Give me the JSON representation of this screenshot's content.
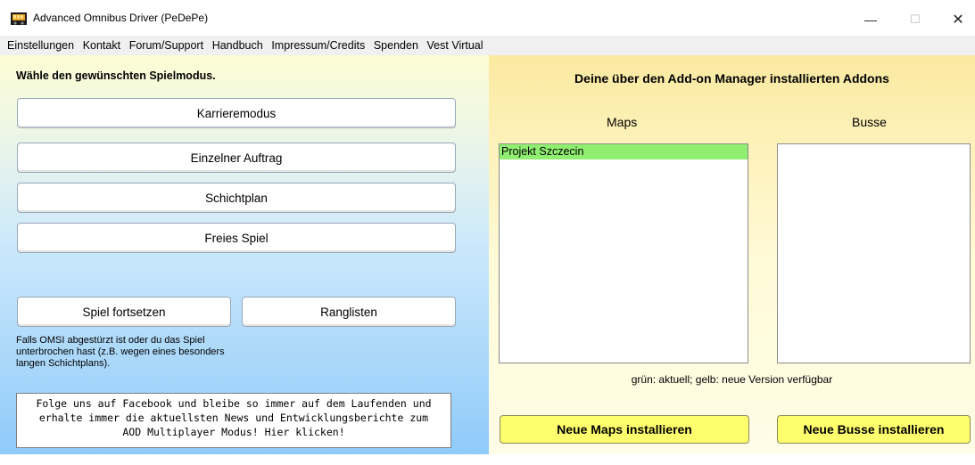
{
  "window": {
    "title": "Advanced Omnibus Driver (PeDePe)",
    "minimize_glyph": "—",
    "maximize_glyph": "☐",
    "close_glyph": "✕"
  },
  "menu": {
    "items": [
      "Einstellungen",
      "Kontakt",
      "Forum/Support",
      "Handbuch",
      "Impressum/Credits",
      "Spenden",
      "Vest Virtual"
    ]
  },
  "left": {
    "prompt": "Wähle den gewünschten Spielmodus.",
    "buttons": {
      "career": "Karrieremodus",
      "single_job": "Einzelner Auftrag",
      "schedule": "Schichtplan",
      "free_play": "Freies Spiel",
      "continue": "Spiel fortsetzen",
      "rankings": "Ranglisten"
    },
    "hint": "Falls OMSI abgestürzt ist oder du das Spiel unterbrochen hast (z.B. wegen eines besonders langen Schichtplans).",
    "facebook": {
      "line1": "Folge uns auf Facebook und bleibe so immer auf dem Laufenden und",
      "line2": "erhalte immer die aktuellsten News und Entwicklungsberichte zum",
      "line3": "AOD Multiplayer Modus! Hier klicken!"
    }
  },
  "right": {
    "title": "Deine über den Add-on Manager installierten Addons",
    "maps_label": "Maps",
    "busses_label": "Busse",
    "maps": [
      "Projekt Szczecin"
    ],
    "busses": [],
    "legend": "grün: aktuell;   gelb: neue Version verfügbar",
    "install_maps": "Neue Maps installieren",
    "install_busses": "Neue Busse installieren"
  },
  "colors": {
    "installed_current": "#90ee70",
    "install_button": "#ffff6e"
  },
  "icons": [
    "app-icon",
    "minimize-icon",
    "maximize-icon",
    "close-icon"
  ]
}
